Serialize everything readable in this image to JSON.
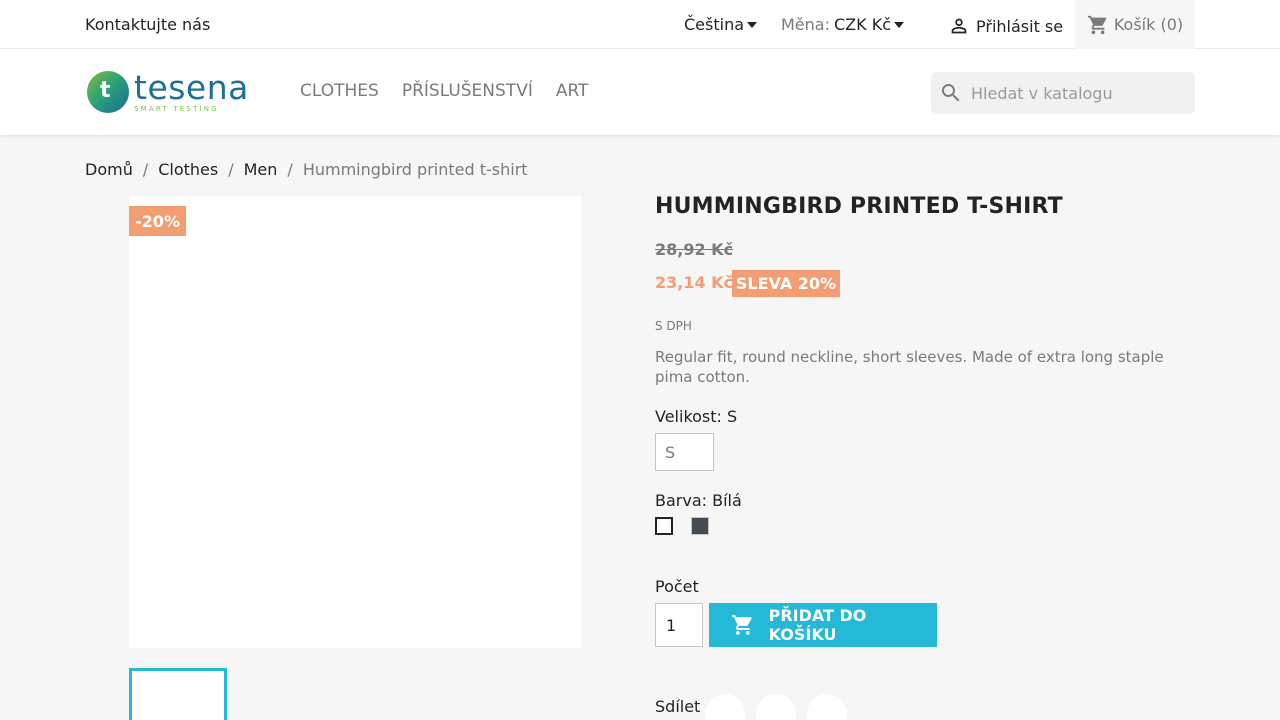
{
  "topbar": {
    "contact": "Kontaktujte nás",
    "language": "Čeština",
    "currency_label": "Měna:",
    "currency_value": "CZK Kč",
    "login": "Přihlásit se",
    "cart": "Košík (0)"
  },
  "header": {
    "logo_name": "tesena",
    "logo_tagline": "SMART TESTING",
    "nav": [
      "CLOTHES",
      "PŘÍSLUŠENSTVÍ",
      "ART"
    ],
    "search_placeholder": "Hledat v katalogu"
  },
  "breadcrumb": [
    "Domů",
    "Clothes",
    "Men",
    "Hummingbird printed t-shirt"
  ],
  "product": {
    "discount_flag": "-20%",
    "title": "HUMMINGBIRD PRINTED T-SHIRT",
    "old_price": "28,92 Kč",
    "new_price": "23,14 Kč",
    "sale_badge": "SLEVA 20%",
    "tax_label": "S DPH",
    "description": "Regular fit, round neckline, short sleeves. Made of extra long staple pima cotton.",
    "size_label": "Velikost: S",
    "size_value": "S",
    "color_label": "Barva: Bílá",
    "colors": [
      "#ffffff",
      "#434a54"
    ],
    "quantity_label": "Počet",
    "quantity_value": "1",
    "add_to_cart": "PŘIDAT DO KOŠÍKU",
    "share_label": "Sdílet"
  },
  "colors": {
    "accent": "#24b9d7",
    "sale": "#f39d72",
    "muted": "#7a7a7a"
  }
}
